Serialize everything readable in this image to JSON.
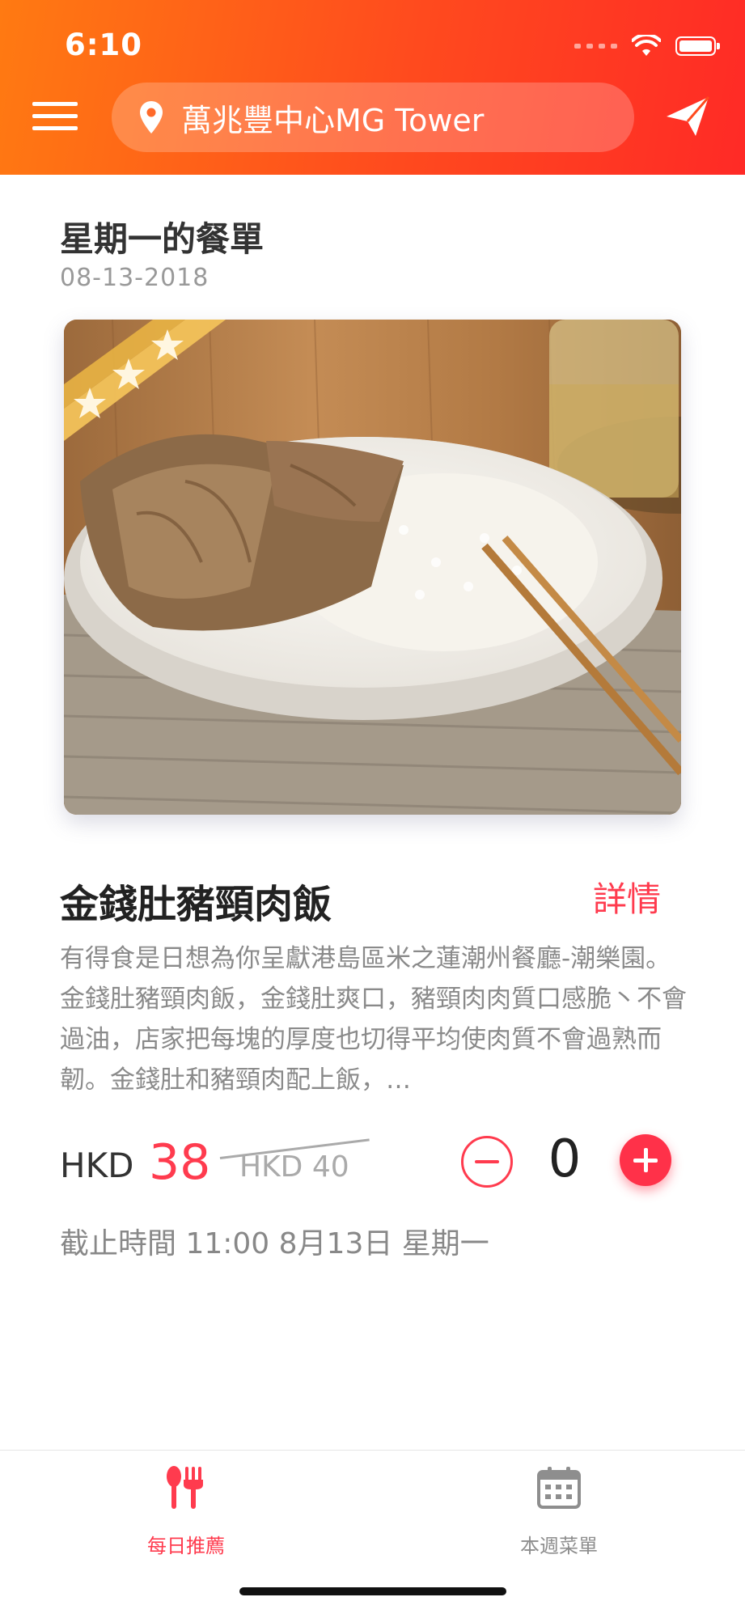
{
  "status_bar": {
    "time": "6:10"
  },
  "header": {
    "location": "萬兆豐中心MG Tower"
  },
  "menu": {
    "title": "星期一的餐單",
    "date": "08-13-2018"
  },
  "dish": {
    "name": "金錢肚豬頸肉飯",
    "details_label": "詳情",
    "description": "有得食是日想為你呈獻港島區米之蓮潮州餐廳-潮樂園。金錢肚豬頸肉飯，金錢肚爽口，豬頸肉肉質口感脆丶不會過油，店家把每塊的厚度也切得平均使肉質不會過熟而韌。金錢肚和豬頸肉配上飯，…",
    "currency": "HKD",
    "price": "38",
    "original_price": "HKD 40",
    "quantity": "0",
    "deadline": "截止時間 11:00 8月13日 星期一",
    "badge": "star-ribbon"
  },
  "tabbar": {
    "tabs": [
      {
        "label": "每日推薦",
        "icon": "cutlery-icon",
        "active": true
      },
      {
        "label": "本週菜單",
        "icon": "calendar-icon",
        "active": false
      }
    ]
  },
  "colors": {
    "accent": "#ff3b4e",
    "header_start": "#ff7a12",
    "header_end": "#ff2a26",
    "inactive": "#8e8e8e"
  }
}
